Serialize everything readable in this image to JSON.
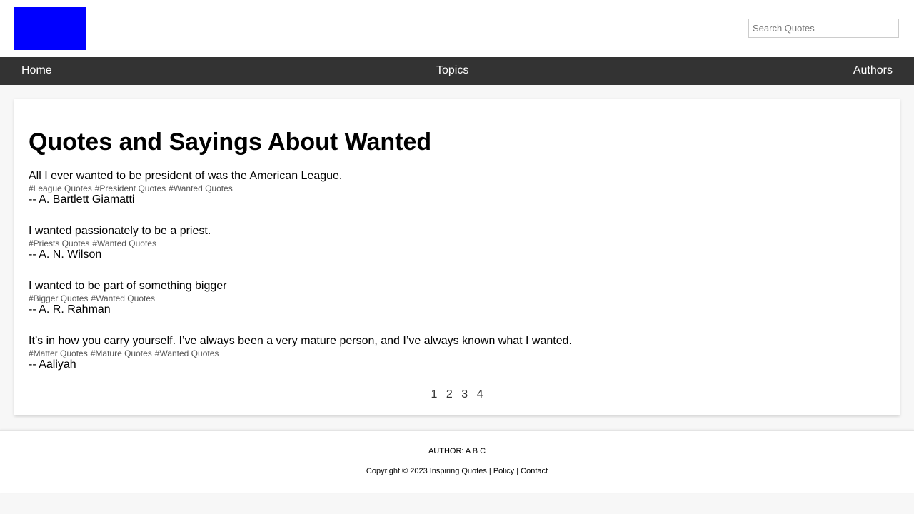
{
  "header": {
    "logo_color": "#0000ff",
    "search_placeholder": "Search Quotes",
    "search_value": ""
  },
  "nav": {
    "home": "Home",
    "topics": "Topics",
    "authors": "Authors"
  },
  "main": {
    "title": "Quotes and Sayings About Wanted",
    "quotes": [
      {
        "text": "All I ever wanted to be president of was the American League.",
        "tags": [
          "#League Quotes",
          "#President Quotes",
          "#Wanted Quotes"
        ],
        "author": "-- A. Bartlett Giamatti"
      },
      {
        "text": "I wanted passionately to be a priest.",
        "tags": [
          "#Priests Quotes",
          "#Wanted Quotes"
        ],
        "author": "-- A. N. Wilson"
      },
      {
        "text": "I wanted to be part of something bigger",
        "tags": [
          "#Bigger Quotes",
          "#Wanted Quotes"
        ],
        "author": "-- A. R. Rahman"
      },
      {
        "text": "It’s in how you carry yourself. I’ve always been a very mature person, and I’ve always known what I wanted.",
        "tags": [
          "#Matter Quotes",
          "#Mature Quotes",
          "#Wanted Quotes"
        ],
        "author": "-- Aaliyah"
      }
    ],
    "pages": [
      "1",
      "2",
      "3",
      "4"
    ]
  },
  "footer": {
    "author_prefix": "AUTHOR:",
    "author_letters": [
      "A",
      "B",
      "C"
    ],
    "copyright": "Copyright © 2023 Inspiring Quotes",
    "separator": "|",
    "policy": "Policy",
    "contact": "Contact"
  }
}
